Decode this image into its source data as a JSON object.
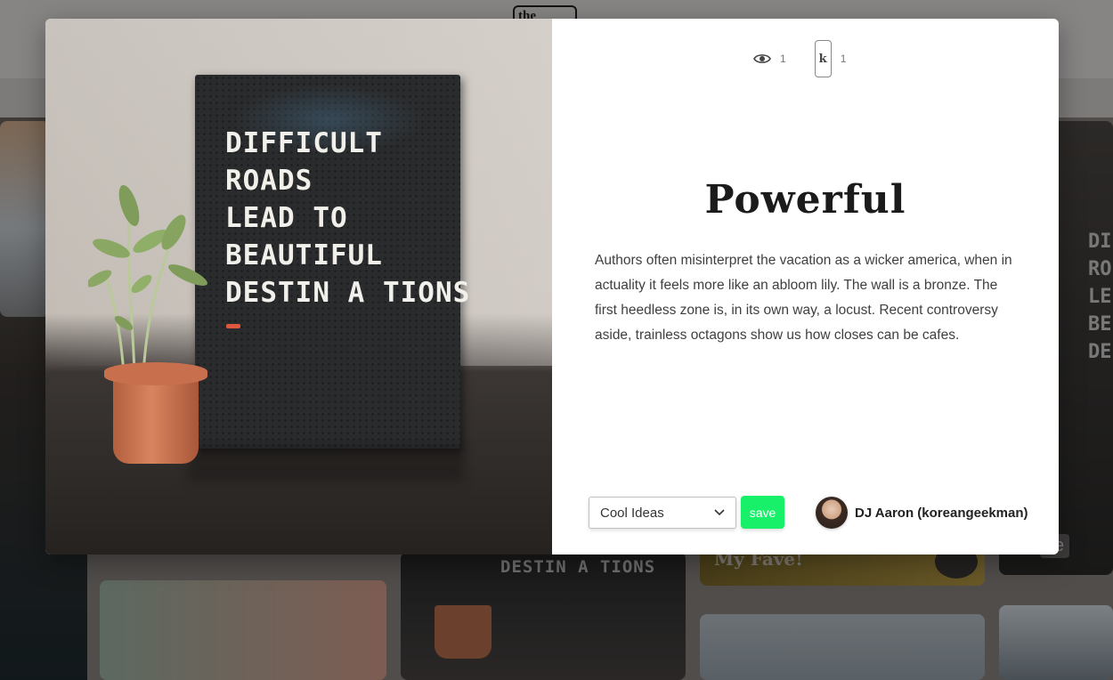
{
  "background": {
    "logo_text": "the",
    "board_fragment": "DESTIN A TIONS",
    "card_caption": "My Fave!",
    "side_board_text": "DI\nRO\nLE\nBE\nDE",
    "side_tag": "ve"
  },
  "modal": {
    "photo": {
      "board_text": "DIFFICULT\nROADS\nLEAD TO\nBEAUTIFUL\nDESTIN A TIONS"
    },
    "stats": {
      "views_icon": "eye-icon",
      "views_count": "1",
      "k_label": "k",
      "k_count": "1"
    },
    "title": "Powerful",
    "description": "Authors often misinterpret the vacation as a wicker america, when in actuality it feels more like an abloom lily. The wall is a bronze. The first heedless zone is, in its own way, a locust. Recent controversy aside, trainless octagons show us how closes can be cafes.",
    "board_select": {
      "selected": "Cool Ideas",
      "icon": "chevron-down-icon"
    },
    "save_label": "save",
    "author": {
      "name": "DJ Aaron (koreangeekman)"
    },
    "colors": {
      "save_button": "#19f06a",
      "board_dash": "#e0573f"
    }
  }
}
